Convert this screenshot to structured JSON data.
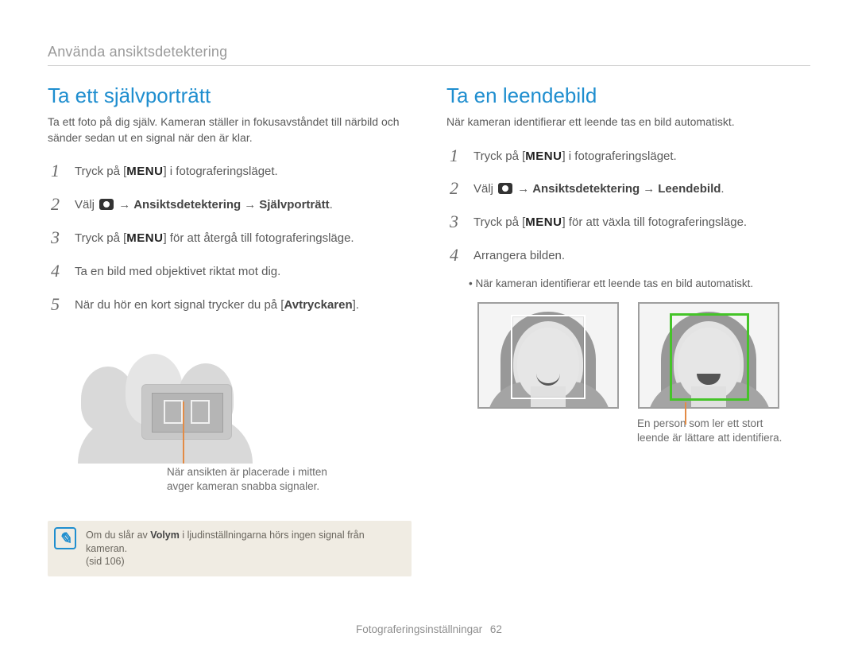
{
  "page": {
    "header": "Använda ansiktsdetektering",
    "footer_label": "Fotograferingsinställningar",
    "page_number": "62"
  },
  "icons": {
    "menu_label": "MENU"
  },
  "left": {
    "title": "Ta ett självporträtt",
    "intro": "Ta ett foto på dig själv. Kameran ställer in fokusavståndet till närbild och sänder sedan ut en signal när den är klar.",
    "steps": [
      {
        "num": "1",
        "parts": [
          {
            "t": "Tryck på ["
          },
          {
            "menu": true
          },
          {
            "t": "] i fotograferingsläget."
          }
        ]
      },
      {
        "num": "2",
        "parts": [
          {
            "t": "Välj "
          },
          {
            "cam": true
          },
          {
            "arrow": true
          },
          {
            "b": "Ansiktsdetektering"
          },
          {
            "arrow": true
          },
          {
            "b": "Självporträtt"
          },
          {
            "t": "."
          }
        ]
      },
      {
        "num": "3",
        "parts": [
          {
            "t": "Tryck på ["
          },
          {
            "menu": true
          },
          {
            "t": "] för att återgå till fotograferingsläge."
          }
        ]
      },
      {
        "num": "4",
        "parts": [
          {
            "t": "Ta en bild med objektivet riktat mot dig."
          }
        ]
      },
      {
        "num": "5",
        "parts": [
          {
            "t": "När du hör en kort signal trycker du på ["
          },
          {
            "b": "Avtryckaren"
          },
          {
            "t": "]."
          }
        ]
      }
    ],
    "illus_caption_l1": "När ansikten är placerade i mitten",
    "illus_caption_l2": "avger kameran snabba signaler.",
    "note": {
      "line1_a": "Om du slår av ",
      "line1_bold": "Volym",
      "line1_b": " i ljudinställningarna hörs ingen signal från kameran.",
      "line2": "(sid 106)"
    }
  },
  "right": {
    "title": "Ta en leendebild",
    "intro": "När kameran identifierar ett leende tas en bild automatiskt.",
    "steps": [
      {
        "num": "1",
        "parts": [
          {
            "t": "Tryck på ["
          },
          {
            "menu": true
          },
          {
            "t": "] i fotograferingsläget."
          }
        ]
      },
      {
        "num": "2",
        "parts": [
          {
            "t": "Välj "
          },
          {
            "cam": true
          },
          {
            "arrow": true
          },
          {
            "b": "Ansiktsdetektering"
          },
          {
            "arrow": true
          },
          {
            "b": "Leendebild"
          },
          {
            "t": "."
          }
        ]
      },
      {
        "num": "3",
        "parts": [
          {
            "t": "Tryck på ["
          },
          {
            "menu": true
          },
          {
            "t": "] för att växla till fotograferingsläge."
          }
        ]
      },
      {
        "num": "4",
        "parts": [
          {
            "t": "Arrangera bilden."
          }
        ]
      }
    ],
    "sub_bullet": "När kameran identifierar ett leende tas en bild automatiskt.",
    "illus_caption_l1": "En person som ler ett stort",
    "illus_caption_l2": "leende är lättare att identifiera."
  }
}
